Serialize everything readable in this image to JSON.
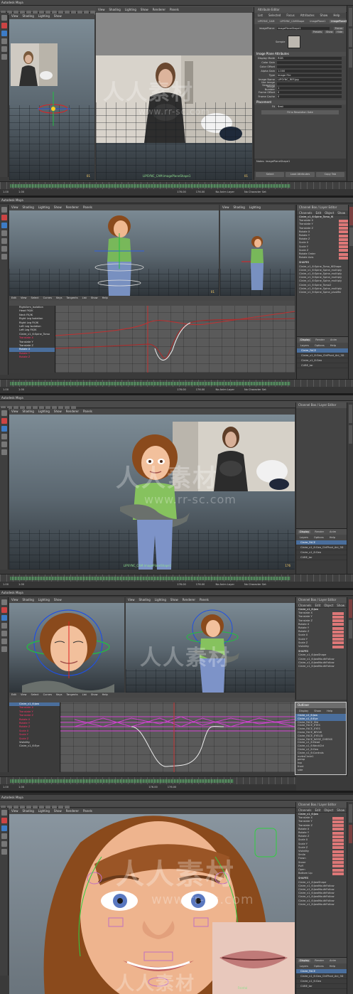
{
  "app": {
    "title": "Autodesk Maya"
  },
  "viewport_menu": [
    "View",
    "Shading",
    "Lighting",
    "Show",
    "Renderer",
    "Panels"
  ],
  "panel1": {
    "image_plane_label": "LIPSYNC_CAM:imagePlaneShape1",
    "left_frame": "01",
    "right_frame": "01",
    "attr_editor": {
      "title": "Attribute Editor",
      "menu": [
        "List",
        "Selected",
        "Focus",
        "Attributes",
        "Show",
        "Help"
      ],
      "tabs": [
        "LIPSYNC_CAM",
        "LIPSYNC_CAMShape",
        "imagePlane1",
        "imagePlaneShape1"
      ],
      "node_label": "imagePlane:",
      "node_value": "imagePlaneShape1",
      "focus_btn": "Focus",
      "presets_btn": "Presets",
      "show_btn": "Show",
      "hide_btn": "Hide",
      "sample_label": "Sample",
      "section_header": "Image Plane Attributes",
      "fields": [
        {
          "label": "Display Mode",
          "value": "RGB"
        },
        {
          "label": "Color Gain",
          "value": ""
        },
        {
          "label": "Color Offset",
          "value": ""
        },
        {
          "label": "Alpha Gain",
          "value": "1.000"
        },
        {
          "label": "Type",
          "value": "Image File"
        },
        {
          "label": "Image Name",
          "value": "LIPSYNC_REF.jpg"
        },
        {
          "label": "Use Image Sequence",
          "value": ""
        },
        {
          "label": "Image Number",
          "value": "1"
        },
        {
          "label": "Frame Offset",
          "value": "0"
        },
        {
          "label": "Frame Cache",
          "value": "0"
        }
      ],
      "placement_header": "Placement",
      "fit_label": "Fit",
      "fit_value": "Best",
      "fit_btn": "Fit to Resolution Gate",
      "notes_label": "Notes:",
      "notes_value": "imagePlaneShape1",
      "buttons": [
        "Select",
        "Load Attributes",
        "Copy Tab"
      ]
    }
  },
  "panel2": {
    "channel_box": {
      "title": "Channel Box / Layer Editor",
      "menu": [
        "Channels",
        "Edit",
        "Object",
        "Show"
      ],
      "object": "Claire_v1_6:Spine_Torso_IK",
      "channels": [
        "Translate X",
        "Translate Y",
        "Translate Z",
        "Rotate X",
        "Rotate Y",
        "Rotate Z",
        "Scale X",
        "Scale Y",
        "Scale Z",
        "Rotate Order",
        "Rotate Axis"
      ],
      "shapes_label": "SHAPES",
      "inputs_label": "INPUTS",
      "shape_items": [
        "Claire_v1_6:Spine_Torso_IKShape",
        "Claire_v1_6:Spine_Spine_multiply",
        "Claire_v1_6:Spine_Spine_multiply",
        "Claire_v1_6:Spine_Spine_multiply",
        "Claire_v1_6:Spine_Spine_multiply",
        "Claire_v1_6:Spine_Torso2",
        "Claire_v1_6:Spine_Spine_multiply",
        "Claire_v1_6:Spine_Spine_plusMin"
      ]
    },
    "layer_tabs": [
      "Display",
      "Render",
      "Anim"
    ],
    "layer_menu": [
      "Layers",
      "Options",
      "Help"
    ],
    "layers": [
      "Claire_FACE",
      "Claire_v1_6:Geo_CtrlPivot_Ani_3D",
      "Claire_v1_6:Geo",
      "CUBE_tar"
    ],
    "graph_menu": [
      "Edit",
      "View",
      "Select",
      "Curves",
      "Keys",
      "Tangents",
      "List",
      "Show",
      "Help"
    ],
    "outliner_items": [
      {
        "name": "RightArm_Isolation",
        "cls": ""
      },
      {
        "name": "Head FK/IK",
        "cls": ""
      },
      {
        "name": "Neck FK/IK",
        "cls": ""
      },
      {
        "name": "Right Leg Isolation",
        "cls": ""
      },
      {
        "name": "Right Leg FK/IK",
        "cls": ""
      },
      {
        "name": "Left Leg Isolation",
        "cls": ""
      },
      {
        "name": "Left Leg FK/IK",
        "cls": ""
      },
      {
        "name": "Claire_v1_6:Spine_Torso",
        "cls": ""
      },
      {
        "name": "Translate X",
        "cls": "r"
      },
      {
        "name": "Translate Y",
        "cls": ""
      },
      {
        "name": "Translate Z",
        "cls": ""
      },
      {
        "name": "Rotate X",
        "cls": "sel"
      },
      {
        "name": "Rotate Y",
        "cls": "r"
      },
      {
        "name": "Rotate Z",
        "cls": "r"
      }
    ],
    "frame": "01"
  },
  "panel3": {
    "channel_box_title": "Channel Box / Layer Editor",
    "layer_tabs": [
      "Display",
      "Render",
      "Anim"
    ],
    "layer_menu": [
      "Layers",
      "Options",
      "Help"
    ],
    "layers": [
      "Claire_FACE",
      "Claire_v1_6:Geo_CtrlPivot_Ani_3D",
      "Claire_v1_6:Geo",
      "CUBE_tar"
    ],
    "label": "LIPSYNC_CAM:imagePlaneShape1",
    "frame": "176"
  },
  "panel4": {
    "channel_box": {
      "title": "Channel Box / Layer Editor",
      "menu": [
        "Channels",
        "Edit",
        "Object",
        "Show"
      ],
      "object": "Claire_v1_6:Jaw",
      "channels": [
        "Translate X",
        "Translate Y",
        "Translate Z",
        "Rotate X",
        "Rotate Y",
        "Rotate Z",
        "Scale X",
        "Scale Y",
        "Scale Z",
        "Visibility"
      ],
      "shapes_label": "SHAPES",
      "inputs_label": "INPUTS",
      "shape_items": [
        "Claire_v1_6:JawShape",
        "Claire_v1_6:JawMouthFollow",
        "Claire_v1_6:JawMouthFollow",
        "Claire_v1_6:JawMouthFollow"
      ]
    },
    "outliner_title": "Outliner",
    "outliner_menu": [
      "Display",
      "Show",
      "Help"
    ],
    "outliner_items": [
      "Claire_v1_6:Jaw",
      "Claire_v1_6:Eye",
      "Claire_FACE_Mid",
      "Claire_FACE_EYES",
      "Claire_FACE_EYES",
      "Claire_FACE_BROW",
      "Claire_FACE_EYELID",
      "Claire_FACE_NOSE_CHEEKS",
      "Claire_v1_6:Head",
      "Claire_v1_6:NeckCtrl",
      "Claire_v1_6:Geo",
      "Claire_v1_6:Controls",
      "nurbsCircle1",
      "persp",
      "top",
      "front",
      "side"
    ],
    "graph_items": [
      {
        "name": "Claire_v1_6:Jaw",
        "cls": "sel"
      },
      {
        "name": "Translate X",
        "cls": "r"
      },
      {
        "name": "Translate Y",
        "cls": "r"
      },
      {
        "name": "Translate Z",
        "cls": "r"
      },
      {
        "name": "Rotate X",
        "cls": "r"
      },
      {
        "name": "Rotate Y",
        "cls": "r"
      },
      {
        "name": "Rotate Z",
        "cls": "r"
      },
      {
        "name": "Scale X",
        "cls": "r"
      },
      {
        "name": "Scale Y",
        "cls": "r"
      },
      {
        "name": "Scale Z",
        "cls": "r"
      },
      {
        "name": "Visibility",
        "cls": ""
      },
      {
        "name": "Claire_v1_6:Eye",
        "cls": ""
      }
    ]
  },
  "panel5": {
    "channel_box_title": "Channel Box / Layer Editor",
    "menu": [
      "Channels",
      "Edit",
      "Object",
      "Show"
    ],
    "object": "Claire_v1_6:Jaw",
    "channels": [
      "Translate X",
      "Translate Y",
      "Translate Z",
      "Rotate X",
      "Rotate Y",
      "Rotate Z",
      "Scale X",
      "Scale Y",
      "Scale Z",
      "Visibility",
      "Smile",
      "Frown",
      "Sneer",
      "Puff",
      "Open",
      "Bottom Lip"
    ],
    "shapes_label": "SHAPES",
    "inputs_label": "INPUTS",
    "shape_items": [
      "Claire_v1_6:JawShape",
      "Claire_v1_6:JawMouthFollow",
      "Claire_v1_6:JawMouthFollow",
      "Claire_v1_6:JawMouthFollow",
      "Claire_v1_6:JawMouthFollow",
      "Claire_v1_6:JawMouthFollow",
      "Claire_v1_6:JawMouthFollow"
    ],
    "layer_tabs": [
      "Display",
      "Render",
      "Anim"
    ],
    "layer_menu": [
      "Layers",
      "Options",
      "Help"
    ],
    "layers": [
      "Claire_FACE",
      "Claire_v1_6:Geo_CtrlPivot_Ani_3D",
      "Claire_v1_6:Geo",
      "CUBE_tar"
    ],
    "label": "Frontal"
  },
  "timeline": {
    "start": "1.00",
    "end": "176.00",
    "range_start": "1.00",
    "range_end": "176.00",
    "anim_layer": "No Anim Layer",
    "char_set": "No Character Set"
  },
  "watermark": {
    "text": "人人素材",
    "url": "www.rr-sc.com"
  },
  "colors": {
    "keyed": "#d77777",
    "selected": "#4a6e9c",
    "curve_red": "#c03030",
    "timeline_wave": "#4c8a58"
  }
}
